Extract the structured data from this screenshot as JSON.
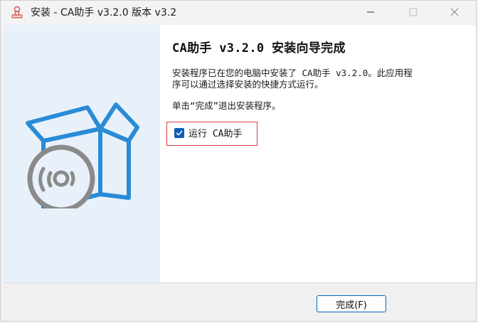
{
  "window": {
    "title": "安装 - CA助手 v3.2.0 版本 v3.2"
  },
  "titlebar": {
    "app_icon": "installer-stamp-icon",
    "minimize_icon": "minimize-icon",
    "maximize_icon": "maximize-icon",
    "close_icon": "close-icon"
  },
  "sidebar": {
    "illustration": "box-with-disc-icon",
    "colors": {
      "box": "#2a8bd6",
      "disc": "#8a8a8a",
      "background": "#e8f1fa"
    }
  },
  "content": {
    "heading": "CA助手 v3.2.0 安装向导完成",
    "paragraph1_line1": "安装程序已在您的电脑中安装了 CA助手 v3.2.0。此应用程",
    "paragraph1_line2": "序可以通过选择安装的快捷方式运行。",
    "paragraph2": "单击“完成”退出安装程序。",
    "run_checkbox": {
      "label": "运行 CA助手",
      "checked": true
    }
  },
  "footer": {
    "finish_button": "完成(F)"
  },
  "colors": {
    "accent": "#0a5fb4",
    "highlight_border": "#d63a3a"
  }
}
